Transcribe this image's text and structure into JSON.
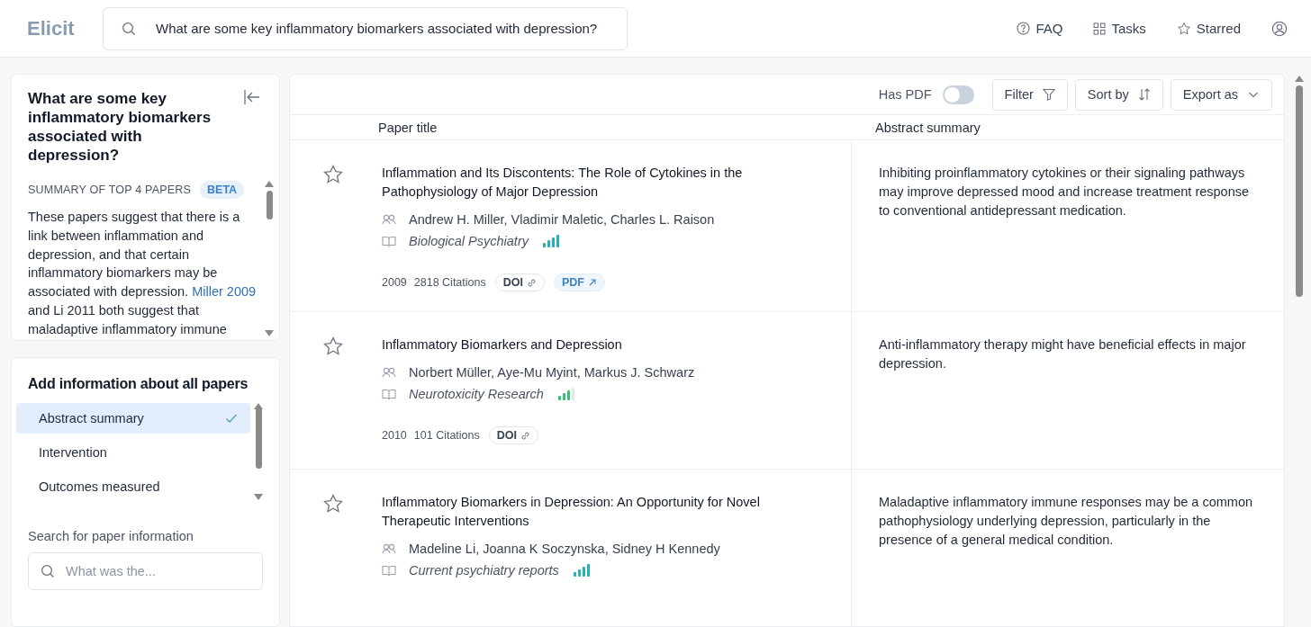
{
  "header": {
    "logo": "Elicit",
    "search": {
      "value": "What are some key inflammatory biomarkers associated with depression?"
    },
    "nav": [
      {
        "kind": "help",
        "label": "FAQ"
      },
      {
        "kind": "grid",
        "label": "Tasks"
      },
      {
        "kind": "star",
        "label": "Starred"
      },
      {
        "kind": "account"
      }
    ]
  },
  "summary_panel": {
    "question": "What are some key inflammatory biomarkers associated with depression?",
    "heading": "SUMMARY OF TOP 4 PAPERS",
    "badge": "BETA",
    "paragraph": {
      "before_link": "These papers suggest that there is a link between inflammation and depression, and that certain inflammatory biomarkers may be associated with depression.",
      "link": "Miller 2009",
      "after_link": "and Li 2011 both suggest that maladaptive inflammatory immune"
    }
  },
  "info_panel": {
    "title": "Add information about all papers",
    "options": [
      {
        "label": "Abstract summary",
        "selected": true
      },
      {
        "label": "Intervention",
        "selected": false
      },
      {
        "label": "Outcomes measured",
        "selected": false
      }
    ],
    "search_label": "Search for paper information",
    "search": {
      "placeholder": "What was the..."
    }
  },
  "toolbar": {
    "has_pdf": {
      "label": "Has PDF",
      "on": false
    },
    "buttons": [
      {
        "kind": "filter",
        "label": "Filter"
      },
      {
        "kind": "sort",
        "label": "Sort by"
      },
      {
        "kind": "dropdown",
        "label": "Export as"
      }
    ]
  },
  "table": {
    "columns": [
      "Paper title",
      "Abstract summary"
    ],
    "rows": [
      {
        "starred": false,
        "title": "Inflammation and Its Discontents: The Role of Cytokines in the Pathophysiology of Major Depression",
        "authors": "Andrew H. Miller, Vladimir Maletic, Charles L. Raison",
        "journal": "Biological Psychiatry",
        "journal_rank": {
          "kind": "four_bars",
          "color": "#27b0b6"
        },
        "year": "2009",
        "citations": "2818 Citations",
        "links": [
          {
            "kind": "doi",
            "label": "DOI"
          },
          {
            "kind": "pdf",
            "label": "PDF"
          }
        ],
        "summary": "Inhibiting proinflammatory cytokines or their signaling pathways may improve depressed mood and increase treatment response to conventional antidepressant medication."
      },
      {
        "starred": false,
        "title": "Inflammatory Biomarkers and Depression",
        "authors": "Norbert Müller, Aye-Mu Myint, Markus J. Schwarz",
        "journal": "Neurotoxicity Research",
        "journal_rank": {
          "kind": "three_bars",
          "color": "#3cbf7a"
        },
        "year": "2010",
        "citations": "101 Citations",
        "links": [
          {
            "kind": "doi",
            "label": "DOI"
          }
        ],
        "summary": "Anti-inflammatory therapy might have beneficial effects in major depression."
      },
      {
        "starred": false,
        "title": "Inflammatory Biomarkers in Depression: An Opportunity for Novel Therapeutic Interventions",
        "authors": "Madeline Li, Joanna K Soczynska, Sidney H Kennedy",
        "journal": "Current psychiatry reports",
        "journal_rank": {
          "kind": "four_bars",
          "color": "#27b0b6"
        },
        "summary": "Maladaptive inflammatory immune responses may be a common pathophysiology underlying depression, particularly in the presence of a general medical condition."
      }
    ]
  }
}
